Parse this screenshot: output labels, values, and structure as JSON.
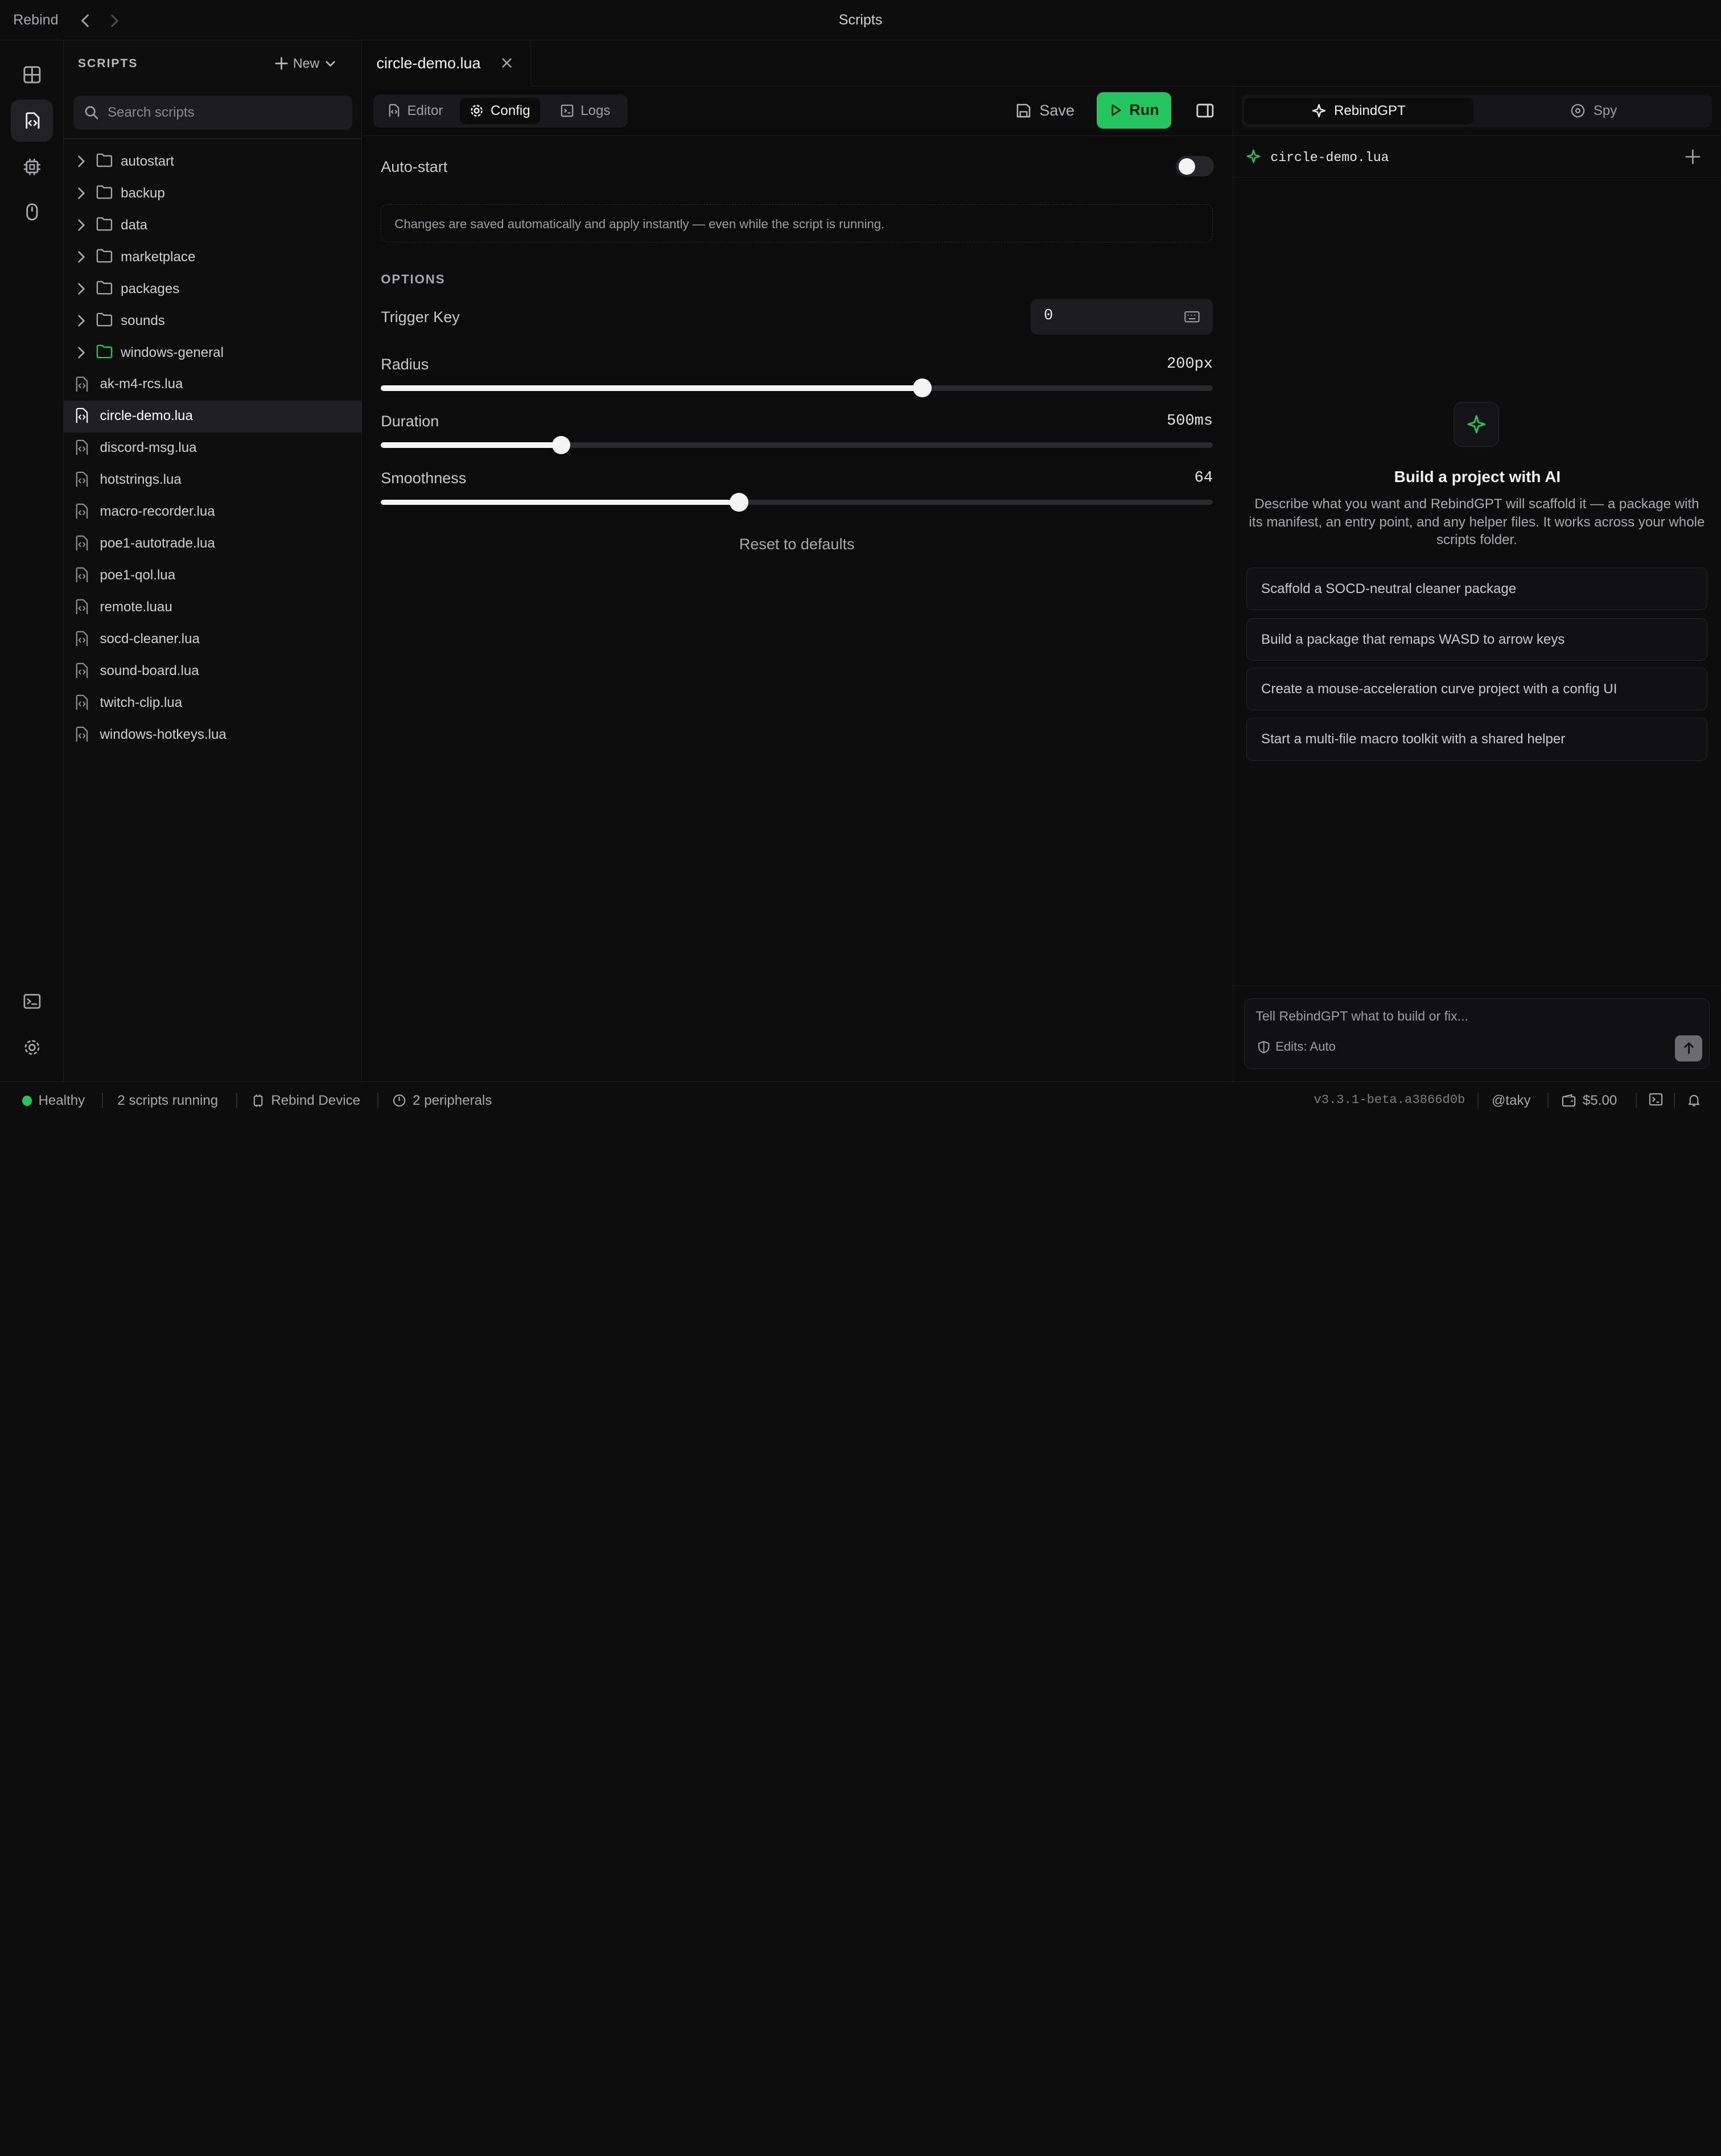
{
  "titlebar": {
    "app_name": "Rebind",
    "title": "Scripts"
  },
  "rail": {
    "items": [
      "dashboard-icon",
      "scripts-icon",
      "device-chip-icon",
      "mouse-icon"
    ],
    "bottom": [
      "terminal-icon",
      "settings-icon"
    ]
  },
  "sidebar": {
    "title": "SCRIPTS",
    "new_label": "New",
    "search_placeholder": "Search scripts",
    "folders": [
      "autostart",
      "backup",
      "data",
      "marketplace",
      "packages",
      "sounds",
      "windows-general"
    ],
    "scripts": [
      "ak-m4-rcs.lua",
      "circle-demo.lua",
      "discord-msg.lua",
      "hotstrings.lua",
      "macro-recorder.lua",
      "poe1-autotrade.lua",
      "poe1-qol.lua",
      "remote.luau",
      "socd-cleaner.lua",
      "sound-board.lua",
      "twitch-clip.lua",
      "windows-hotkeys.lua"
    ],
    "selected_script": "circle-demo.lua",
    "highlighted_folder": "windows-general"
  },
  "editor": {
    "open_tab": "circle-demo.lua",
    "tabs": {
      "editor": "Editor",
      "config": "Config",
      "logs": "Logs"
    },
    "active_tab": "Config",
    "save_label": "Save",
    "run_label": "Run"
  },
  "config": {
    "auto_start_label": "Auto-start",
    "auto_start": false,
    "notice": "Changes are saved automatically and apply instantly — even while the script is running.",
    "options_title": "OPTIONS",
    "trigger_key": {
      "label": "Trigger Key",
      "value": "0"
    },
    "radius": {
      "label": "Radius",
      "display": "200px",
      "fraction": 0.65
    },
    "duration": {
      "label": "Duration",
      "display": "500ms",
      "fraction": 0.216
    },
    "smoothness": {
      "label": "Smoothness",
      "display": "64",
      "fraction": 0.43
    },
    "reset_label": "Reset to defaults"
  },
  "assistant": {
    "tabs": {
      "gpt": "RebindGPT",
      "spy": "Spy"
    },
    "context_file": "circle-demo.lua",
    "heading": "Build a project with AI",
    "description": "Describe what you want and RebindGPT will scaffold it — a package with its manifest, an entry point, and any helper files. It works across your whole scripts folder.",
    "suggestions": [
      "Scaffold a SOCD-neutral cleaner package",
      "Build a package that remaps WASD to arrow keys",
      "Create a mouse-acceleration curve project with a config UI",
      "Start a multi-file macro toolkit with a shared helper"
    ],
    "composer_placeholder": "Tell RebindGPT what to build or fix...",
    "edits_label": "Edits: Auto"
  },
  "status": {
    "health": "Healthy",
    "running": "2 scripts running",
    "device": "Rebind Device",
    "peripherals": "2 peripherals",
    "version": "v3.3.1-beta.a3866d0b",
    "user": "@taky",
    "balance": "$5.00"
  },
  "colors": {
    "accent": "#22c55e",
    "background": "#0c0c0d"
  }
}
